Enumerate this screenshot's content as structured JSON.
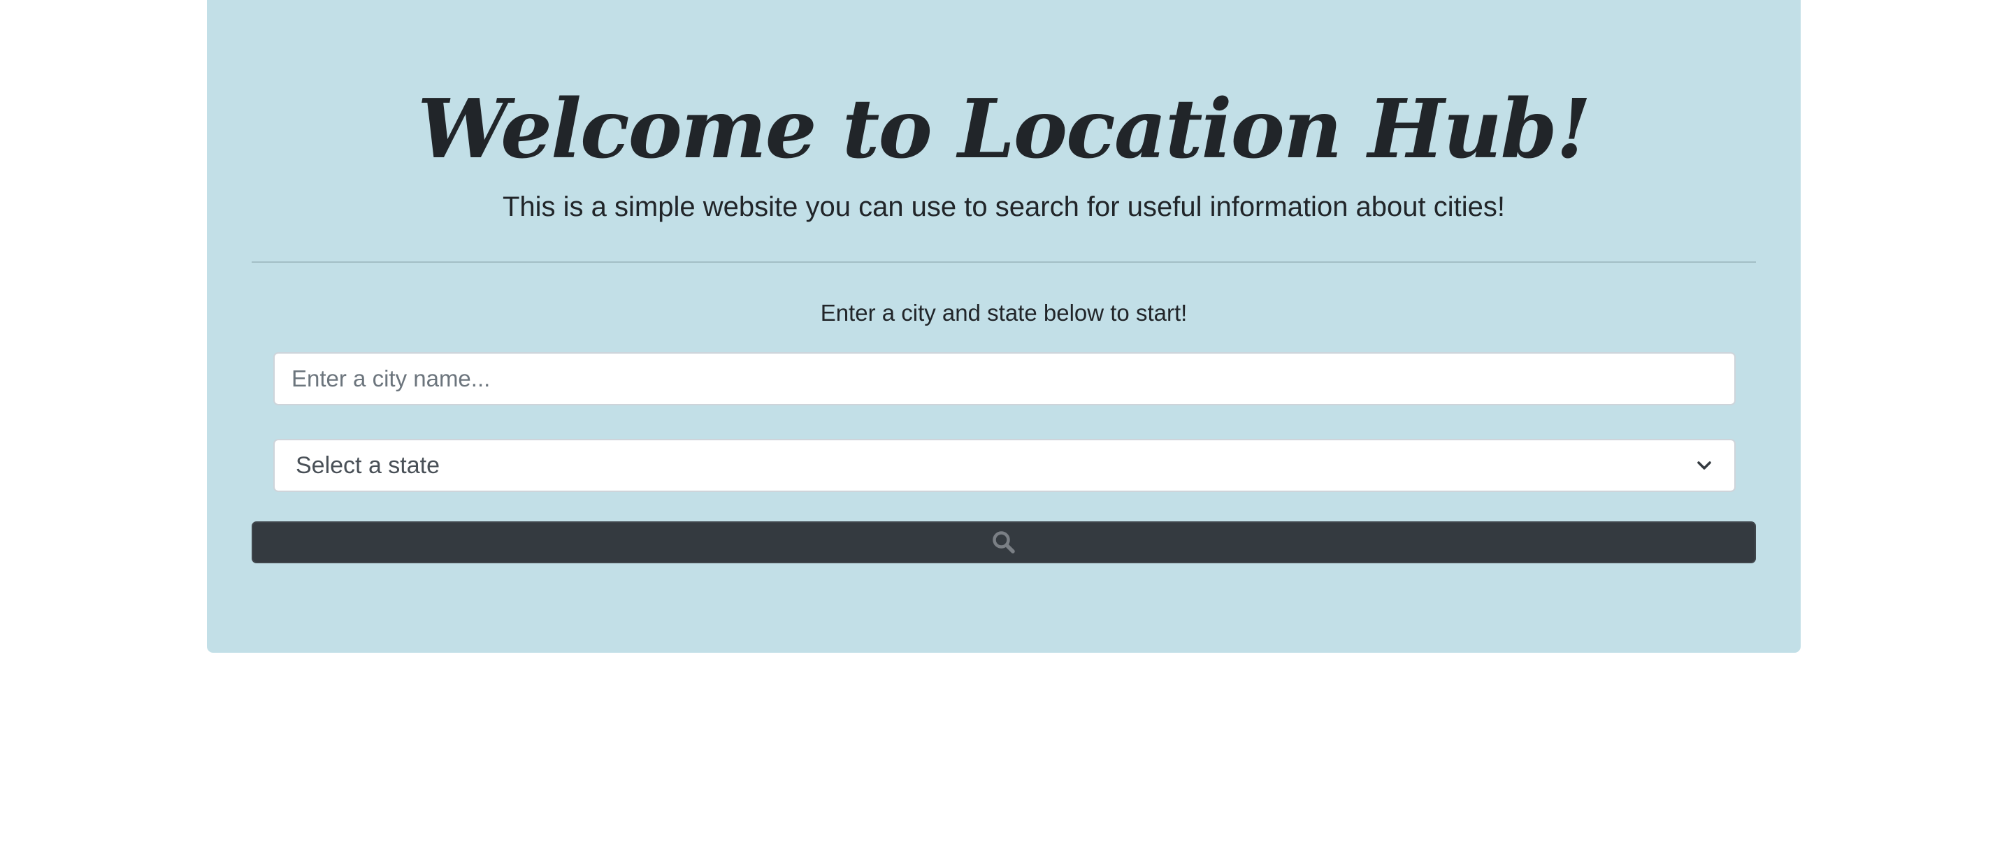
{
  "hero": {
    "title": "Welcome to Location Hub!",
    "lead": "This is a simple website you can use to search for useful information about cities!",
    "prompt": "Enter a city and state below to start!"
  },
  "form": {
    "city_placeholder": "Enter a city name...",
    "city_value": "",
    "state_selected": "Select a state",
    "search_icon": "search-icon"
  },
  "colors": {
    "hero_background": "#c2dfe7",
    "button_background": "#343a40",
    "text": "#212529"
  }
}
